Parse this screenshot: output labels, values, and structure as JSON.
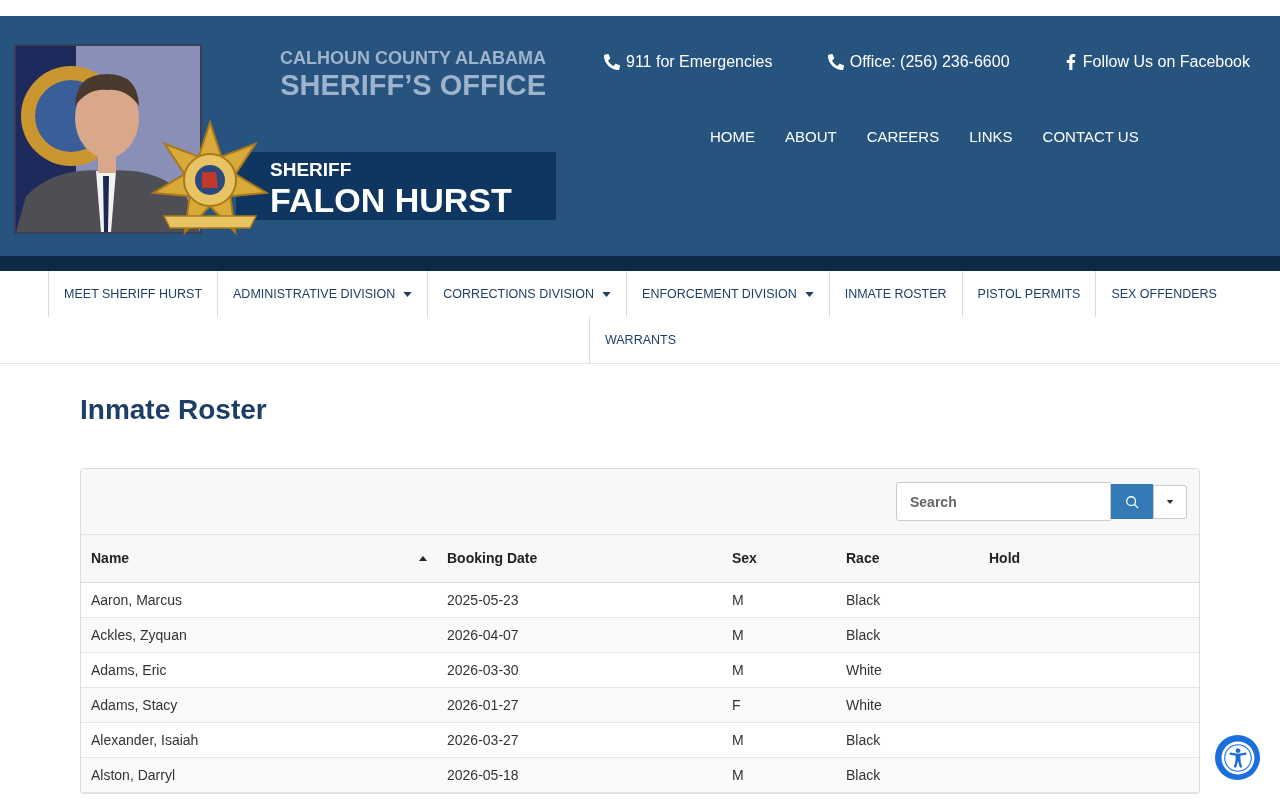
{
  "banner": {
    "county": "CALHOUN COUNTY ALABAMA",
    "office": "SHERIFF’S OFFICE",
    "rank": "SHERIFF",
    "sheriff_name": "FALON HURST"
  },
  "contacts": [
    {
      "kind": "phone",
      "text": "911 for Emergencies"
    },
    {
      "kind": "phone",
      "text": "Office: (256) 236-6600"
    },
    {
      "kind": "facebook",
      "text": "Follow Us on Facebook"
    }
  ],
  "top_nav": [
    "HOME",
    "ABOUT",
    "CAREERS",
    "LINKS",
    "CONTACT US"
  ],
  "main_nav": [
    {
      "label": "MEET SHERIFF HURST",
      "has_menu": false
    },
    {
      "label": "ADMINISTRATIVE DIVISION",
      "has_menu": true
    },
    {
      "label": "CORRECTIONS DIVISION",
      "has_menu": true
    },
    {
      "label": "ENFORCEMENT DIVISION",
      "has_menu": true
    },
    {
      "label": "INMATE ROSTER",
      "has_menu": false
    },
    {
      "label": "PISTOL PERMITS",
      "has_menu": false
    },
    {
      "label": "SEX OFFENDERS",
      "has_menu": false
    },
    {
      "label": "WARRANTS",
      "has_menu": false
    }
  ],
  "page_title": "Inmate Roster",
  "search": {
    "placeholder": "Search"
  },
  "table": {
    "columns": [
      {
        "label": "Name",
        "sorted": true
      },
      {
        "label": "Booking Date",
        "sorted": false
      },
      {
        "label": "Sex",
        "sorted": false
      },
      {
        "label": "Race",
        "sorted": false
      },
      {
        "label": "Hold",
        "sorted": false
      }
    ],
    "rows": [
      [
        "Aaron, Marcus",
        "2025-05-23",
        "M",
        "Black"
      ],
      [
        "Ackles, Zyquan",
        "2026-04-07",
        "M",
        "Black"
      ],
      [
        "Adams, Eric",
        "2026-03-30",
        "M",
        "White"
      ],
      [
        "Adams, Stacy",
        "2026-01-27",
        "F",
        "White"
      ],
      [
        "Alexander, Isaiah",
        "2026-03-27",
        "M",
        "Black"
      ],
      [
        "Alston, Darryl",
        "2026-05-18",
        "M",
        "Black"
      ]
    ]
  }
}
